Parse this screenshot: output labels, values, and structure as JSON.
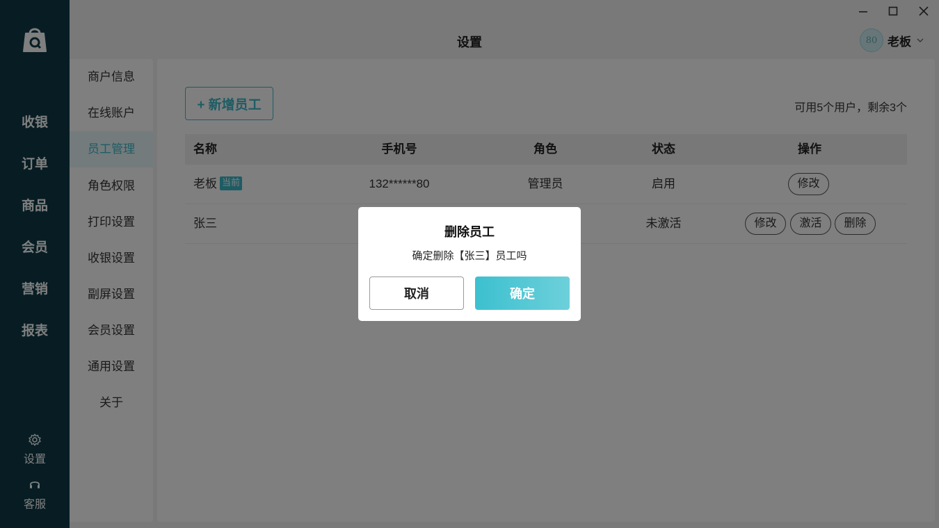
{
  "window": {
    "title": "设置",
    "controls": [
      "minimize-icon",
      "maximize-icon",
      "close-icon"
    ]
  },
  "user": {
    "avatar_text": "80",
    "name": "老板"
  },
  "nav": {
    "logo": "shopping-bag-logo",
    "items": [
      {
        "label": "收银"
      },
      {
        "label": "订单"
      },
      {
        "label": "商品"
      },
      {
        "label": "会员"
      },
      {
        "label": "营销"
      },
      {
        "label": "报表"
      }
    ],
    "settings_label": "设置",
    "service_label": "客服"
  },
  "submenu": {
    "items": [
      {
        "label": "商户信息",
        "active": false
      },
      {
        "label": "在线账户",
        "active": false
      },
      {
        "label": "员工管理",
        "active": true
      },
      {
        "label": "角色权限",
        "active": false
      },
      {
        "label": "打印设置",
        "active": false
      },
      {
        "label": "收银设置",
        "active": false
      },
      {
        "label": "副屏设置",
        "active": false
      },
      {
        "label": "会员设置",
        "active": false
      },
      {
        "label": "通用设置",
        "active": false
      },
      {
        "label": "关于",
        "active": false
      }
    ]
  },
  "main": {
    "add_button": "+ 新增员工",
    "quota": "可用5个用户，剩余3个",
    "columns": [
      "名称",
      "手机号",
      "角色",
      "状态",
      "操作"
    ],
    "rows": [
      {
        "name": "老板",
        "tag": "当前",
        "phone": "132******80",
        "role": "管理员",
        "status": "启用",
        "actions": [
          "修改"
        ]
      },
      {
        "name": "张三",
        "tag": "",
        "phone": "",
        "role": "",
        "status": "未激活",
        "actions": [
          "修改",
          "激活",
          "删除"
        ]
      }
    ]
  },
  "dialog": {
    "title": "删除员工",
    "message": "确定删除【张三】员工吗",
    "cancel": "取消",
    "confirm": "确定"
  },
  "colors": {
    "accent": "#3db8c8",
    "nav_bg": "#0e3a47",
    "overlay": "rgba(0,0,0,0.5)"
  }
}
